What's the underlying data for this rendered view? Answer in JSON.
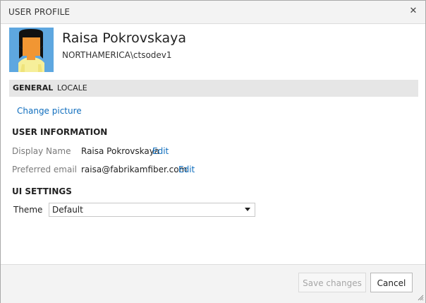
{
  "dialog": {
    "title": "USER PROFILE",
    "close_glyph": "✕"
  },
  "profile": {
    "name": "Raisa Pokrovskaya",
    "account": "NORTHAMERICA\\ctsodev1",
    "avatar_icon": "user-avatar-icon"
  },
  "tabs": [
    {
      "label": "GENERAL",
      "active": true
    },
    {
      "label": "LOCALE",
      "active": false
    }
  ],
  "general": {
    "change_picture": "Change picture",
    "user_information": {
      "heading": "USER INFORMATION",
      "display_name": {
        "label": "Display Name",
        "value": "Raisa Pokrovskaya",
        "edit": "Edit"
      },
      "preferred_email": {
        "label": "Preferred email",
        "value": "raisa@fabrikamfiber.com",
        "edit": "Edit"
      }
    },
    "ui_settings": {
      "heading": "UI SETTINGS",
      "theme": {
        "label": "Theme",
        "value": "Default"
      }
    }
  },
  "footer": {
    "save_label": "Save changes",
    "save_enabled": false,
    "cancel_label": "Cancel"
  },
  "colors": {
    "link": "#106ebe",
    "titlebar": "#f3f3f3",
    "tab_strip": "#e6e6e6"
  }
}
